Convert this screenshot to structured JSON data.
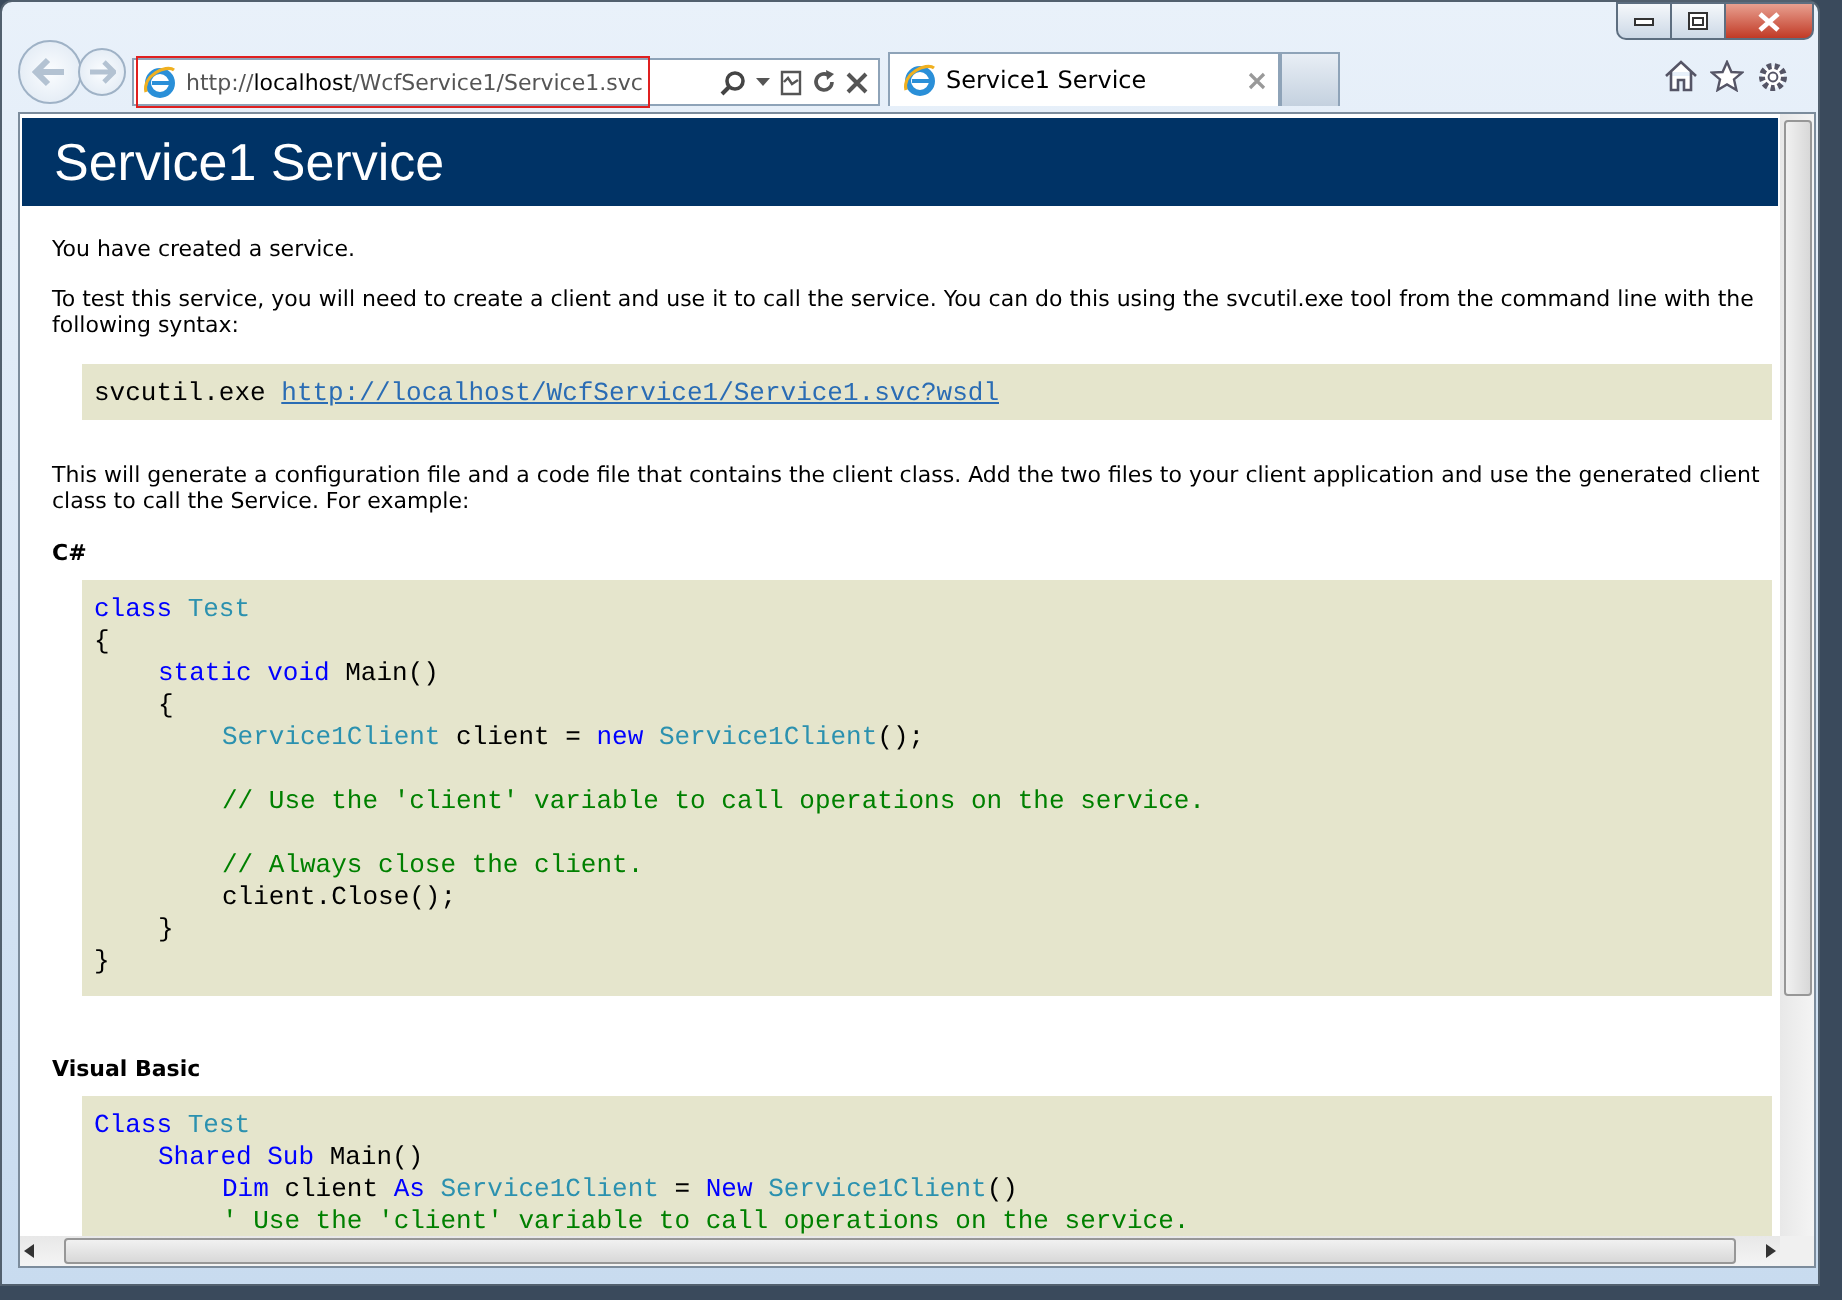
{
  "browser": {
    "address": "http://**localhost**/WcfService1/Service1.svc",
    "tabs": [
      {
        "label": "Service1 Service",
        "selected": true
      }
    ]
  },
  "page": {
    "title": "Service1 Service",
    "intro": "You have created a service.",
    "instructions": "To test this service, you will need to create a client and use it to call the service. You can do this using the svcutil.exe tool from the command line with the following syntax:",
    "command": {
      "text": "svcutil.exe",
      "link": "http://localhost/WcfService1/Service1.svc?wsdl"
    },
    "explanation": "This will generate a configuration file and a code file that contains the client class. Add the two files to your client application and use the generated client class to call the Service. For example:",
    "samples": [
      {
        "heading": "C#",
        "lines": [
          {
            "kind": "code",
            "tokens": [
              {
                "kind": "keyword",
                "text": "class"
              },
              {
                "kind": "type",
                "text": " Test"
              }
            ]
          },
          {
            "kind": "code",
            "tokens": [
              {
                "kind": "plain",
                "text": "{"
              }
            ],
            "children": [
              {
                "kind": "code",
                "tokens": [
                  {
                    "kind": "keyword",
                    "text": "static"
                  },
                  {
                    "kind": "keyword",
                    "text": " void"
                  },
                  {
                    "kind": "plain",
                    "text": " Main()"
                  }
                ]
              },
              {
                "kind": "code",
                "tokens": [
                  {
                    "kind": "plain",
                    "text": "{"
                  }
                ],
                "children": [
                  {
                    "kind": "code",
                    "tokens": [
                      {
                        "kind": "type",
                        "text": "Service1Client"
                      },
                      {
                        "kind": "plain",
                        "text": " client = "
                      },
                      {
                        "kind": "keyword",
                        "text": "new"
                      },
                      {
                        "kind": "type",
                        "text": " Service1Client"
                      },
                      {
                        "kind": "plain",
                        "text": "();"
                      }
                    ]
                  },
                  {
                    "kind": "blank"
                  },
                  {
                    "kind": "code",
                    "tokens": [
                      {
                        "kind": "comment",
                        "text": "// Use the 'client' variable to call operations on the service."
                      }
                    ]
                  },
                  {
                    "kind": "blank"
                  },
                  {
                    "kind": "code",
                    "tokens": [
                      {
                        "kind": "comment",
                        "text": "// Always close the client."
                      }
                    ]
                  },
                  {
                    "kind": "code",
                    "tokens": [
                      {
                        "kind": "plain",
                        "text": "client.Close();"
                      }
                    ]
                  }
                ]
              },
              {
                "kind": "code",
                "tokens": [
                  {
                    "kind": "plain",
                    "text": "}"
                  }
                ]
              }
            ]
          },
          {
            "kind": "code",
            "tokens": [
              {
                "kind": "plain",
                "text": "}"
              }
            ]
          }
        ]
      },
      {
        "heading": "Visual Basic",
        "lines": [
          {
            "kind": "code",
            "tokens": [
              {
                "kind": "keyword",
                "text": "Class"
              },
              {
                "kind": "type",
                "text": " Test"
              }
            ],
            "children": [
              {
                "kind": "code",
                "tokens": [
                  {
                    "kind": "keyword",
                    "text": "Shared"
                  },
                  {
                    "kind": "keyword",
                    "text": " Sub"
                  },
                  {
                    "kind": "plain",
                    "text": " Main()"
                  }
                ],
                "children": [
                  {
                    "kind": "code",
                    "tokens": [
                      {
                        "kind": "keyword",
                        "text": "Dim"
                      },
                      {
                        "kind": "plain",
                        "text": " client "
                      },
                      {
                        "kind": "keyword",
                        "text": "As"
                      },
                      {
                        "kind": "type",
                        "text": " Service1Client"
                      },
                      {
                        "kind": "plain",
                        "text": " = "
                      },
                      {
                        "kind": "keyword",
                        "text": "New"
                      },
                      {
                        "kind": "type",
                        "text": " Service1Client"
                      },
                      {
                        "kind": "plain",
                        "text": "()"
                      }
                    ]
                  },
                  {
                    "kind": "code",
                    "tokens": [
                      {
                        "kind": "comment",
                        "text": "' Use the 'client' variable to call operations on the service."
                      }
                    ]
                  }
                ]
              }
            ]
          }
        ]
      }
    ]
  }
}
